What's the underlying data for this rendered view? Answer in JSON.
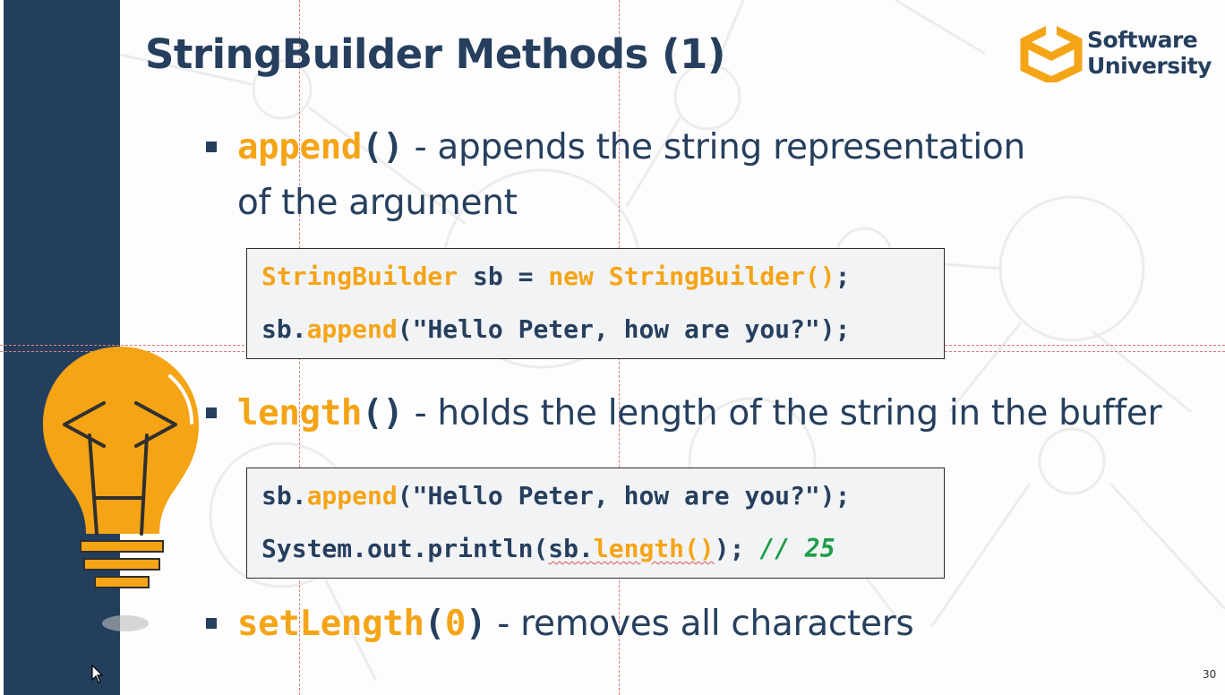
{
  "slide": {
    "title": "StringBuilder Methods (1)",
    "page_number": "30",
    "logo": {
      "line1": "Software",
      "line2": "University",
      "icon": "softuni-logo-icon"
    },
    "colors": {
      "sidebar": "#243f5e",
      "accent": "#f5a416",
      "text": "#263f5e",
      "comment": "#1d9e49"
    }
  },
  "bullets": {
    "append": {
      "method": "append",
      "paren": "()",
      "desc": " - appends the string representation",
      "desc2": "of the argument"
    },
    "length": {
      "method": "length",
      "paren": "()",
      "desc": " - holds the length of the string in the buffer"
    },
    "setlength": {
      "method": "setLength",
      "paren_open": "(",
      "arg": "0",
      "paren_close": ")",
      "desc": " - removes all characters"
    }
  },
  "code1": {
    "line1": {
      "type": "StringBuilder",
      "var": " sb = ",
      "new_kw": "new",
      "space": " ",
      "ctor": "StringBuilder()",
      "end": ";"
    },
    "line2": {
      "obj": "sb.",
      "method": "append",
      "args": "(\"Hello Peter, how are you?\");"
    }
  },
  "code2": {
    "line1": {
      "obj": "sb.",
      "method": "append",
      "args": "(\"Hello Peter, how are you?\");"
    },
    "line2": {
      "prefix": "System.out.println(",
      "obj": "sb.",
      "method": "length()",
      "suffix": "); ",
      "comment": "// 25"
    }
  },
  "icons": {
    "bulb": "lightbulb-icon",
    "cursor": "mouse-cursor-icon"
  }
}
